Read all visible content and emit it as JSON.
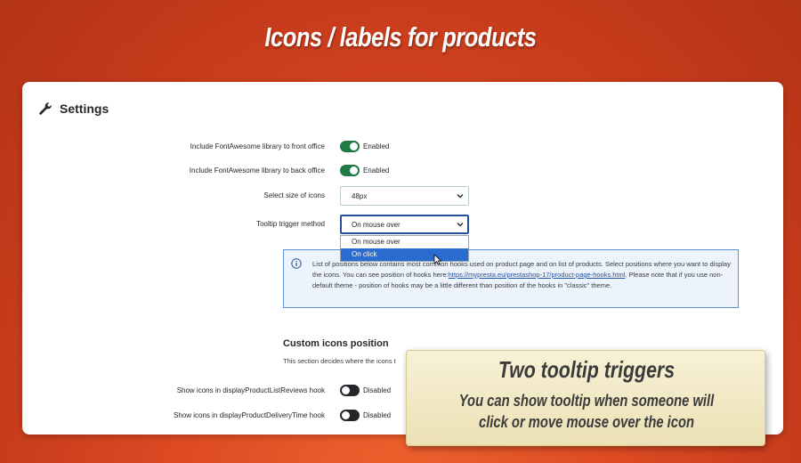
{
  "banner": {
    "title": "Icons / labels for products"
  },
  "panel": {
    "title": "Settings",
    "icon": "wrench-icon"
  },
  "settings": {
    "fa_front": {
      "label": "Include FontAwesome library to front office",
      "value": "Enabled",
      "on": true
    },
    "fa_back": {
      "label": "Include FontAwesome library to back office",
      "value": "Enabled",
      "on": true
    },
    "icon_size": {
      "label": "Select size of icons",
      "value": "48px"
    },
    "tooltip": {
      "label": "Tooltip trigger method",
      "value": "On mouse over",
      "options": [
        "On mouse over",
        "On click"
      ],
      "highlighted": "On click"
    }
  },
  "info": {
    "text_before": "List of positions below contains most common hooks used on product page and on list of products. Select positions where you want to display the icons. You can see position of hooks here:",
    "link": "https://mypresta.eu/prestashop-17/product-page-hooks.html",
    "text_after": ". Please note that if you use non-default theme - position of hooks may be a little different than position of the hooks in \"classic\" theme."
  },
  "custom_section": {
    "title": "Custom icons position",
    "description": "This section decides where the icons t"
  },
  "hooks": [
    {
      "label": "Show icons in displayProductListReviews hook",
      "value": "Disabled",
      "on": false
    },
    {
      "label": "Show icons in displayProductDeliveryTime hook",
      "value": "Disabled",
      "on": false
    }
  ],
  "callout": {
    "title": "Two tooltip triggers",
    "text": "You can show tooltip when someone will click or move mouse over the icon"
  },
  "colors": {
    "background": "#dd4a23",
    "switch_on": "#1f7a45",
    "switch_off": "#25272b",
    "dropdown_selected": "#2a6ccf",
    "info_border": "#5b8fd6",
    "callout_bg": "#f3ebc8"
  }
}
